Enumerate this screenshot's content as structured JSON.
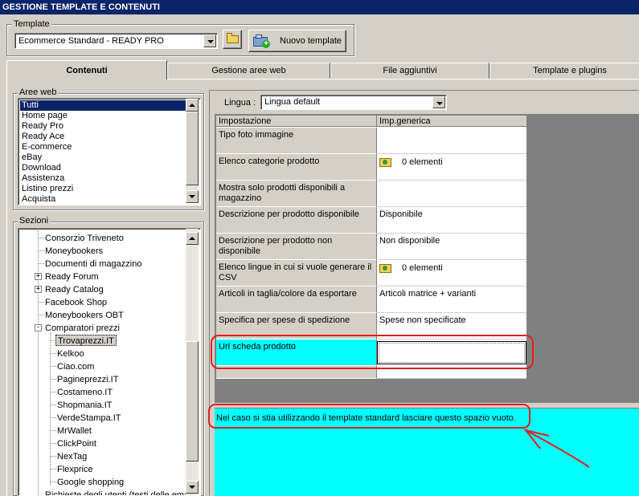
{
  "window": {
    "title": "GESTIONE TEMPLATE E CONTENUTI"
  },
  "template_group": {
    "label": "Template",
    "selected": "Ecommerce Standard - READY PRO",
    "folder_icon": "folder-icon",
    "new_template_label": "Nuovo template"
  },
  "tabs": [
    {
      "label": "Contenuti",
      "active": true
    },
    {
      "label": "Gestione aree web",
      "active": false
    },
    {
      "label": "File aggiuntivi",
      "active": false
    },
    {
      "label": "Template e plugins",
      "active": false
    }
  ],
  "aree_web": {
    "label": "Aree web",
    "items": [
      "Tutti",
      "Home page",
      "Ready Pro",
      "Ready Ace",
      "E-commerce",
      "eBay",
      "Download",
      "Assistenza",
      "Listino prezzi",
      "Acquista"
    ],
    "selected_index": 0
  },
  "sezioni": {
    "label": "Sezioni",
    "items": [
      {
        "label": "Consorzio Triveneto",
        "level": 1
      },
      {
        "label": "Moneybookers",
        "level": 1
      },
      {
        "label": "Documenti di magazzino",
        "level": 1
      },
      {
        "label": "Ready Forum",
        "level": 1,
        "expander": "+"
      },
      {
        "label": "Ready Catalog",
        "level": 1,
        "expander": "+"
      },
      {
        "label": "Facebook Shop",
        "level": 1
      },
      {
        "label": "Moneybookers OBT",
        "level": 1
      },
      {
        "label": "Comparatori prezzi",
        "level": 1,
        "expander": "-"
      },
      {
        "label": "Trovaprezzi.IT",
        "level": 2,
        "selected": true
      },
      {
        "label": "Kelkoo",
        "level": 2
      },
      {
        "label": "Ciao.com",
        "level": 2
      },
      {
        "label": "Pagineprezzi.IT",
        "level": 2
      },
      {
        "label": "Costameno.IT",
        "level": 2
      },
      {
        "label": "Shopmania.IT",
        "level": 2
      },
      {
        "label": "VerdeStampa.IT",
        "level": 2
      },
      {
        "label": "MrWallet",
        "level": 2
      },
      {
        "label": "ClickPoint",
        "level": 2
      },
      {
        "label": "NexTag",
        "level": 2
      },
      {
        "label": "Flexprice",
        "level": 2
      },
      {
        "label": "Google shopping",
        "level": 2
      },
      {
        "label": "Richieste degli utenti (testi delle email)",
        "level": 1
      }
    ]
  },
  "lingua": {
    "label": "Lingua :",
    "selected": "Lingua default"
  },
  "grid": {
    "headers": [
      "Impostazione",
      "Imp.generica"
    ],
    "rows": [
      {
        "name": "Tipo foto immagine",
        "value": ""
      },
      {
        "name": "Elenco categorie prodotto",
        "value": "0 elementi",
        "icon": true
      },
      {
        "name": "Mostra solo prodotti disponibili a magazzino",
        "value": ""
      },
      {
        "name": "Descrizione per prodotto disponibile",
        "value": "Disponibile"
      },
      {
        "name": "Descrizione per prodotto non disponibile",
        "value": "Non disponibile"
      },
      {
        "name": "Elenco lingue in cui si vuole generare il CSV",
        "value": "0 elementi",
        "icon": true
      },
      {
        "name": "Articoli in taglia/colore da esportare",
        "value": "Articoli matrice + varianti"
      },
      {
        "name": "Specifica per spese di spedizione",
        "value": "Spese non specificate"
      },
      {
        "name": "Url scheda prodotto",
        "value": "",
        "highlight": true
      },
      {
        "name": "",
        "value": ""
      }
    ]
  },
  "info": {
    "text": "Nel caso si stia utilizzando il template standard lasciare questo spazio vuoto."
  },
  "colors": {
    "highlight": "#00ffff",
    "annotation": "#e02020",
    "selection": "#0a246a"
  }
}
